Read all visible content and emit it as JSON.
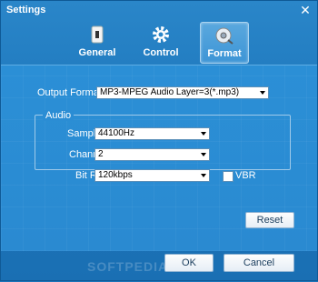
{
  "window": {
    "title": "Settings"
  },
  "tabs": [
    {
      "label": "General",
      "icon": "general-settings-icon"
    },
    {
      "label": "Control",
      "icon": "gear-icon"
    },
    {
      "label": "Format",
      "icon": "disc-icon"
    }
  ],
  "format": {
    "output_format_label": "Output Format:",
    "output_format_value": "MP3-MPEG Audio Layer=3(*.mp3)"
  },
  "audio": {
    "group_title": "Audio",
    "sample_rate_label": "Sample Rate",
    "sample_rate_value": "44100Hz",
    "channels_label": "Channels",
    "channels_value": "2",
    "bit_rate_label": "Bit Rate",
    "bit_rate_value": "120kbps",
    "vbr_label": "VBR"
  },
  "buttons": {
    "reset": "Reset",
    "ok": "OK",
    "cancel": "Cancel"
  },
  "watermark": "SOFTPEDIA"
}
